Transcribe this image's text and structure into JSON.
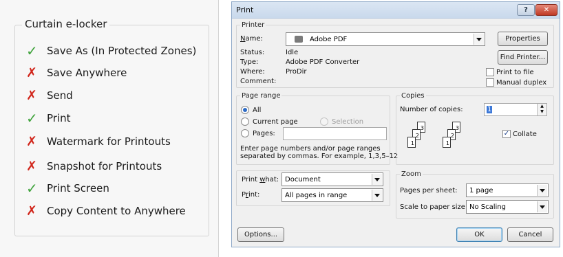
{
  "locker": {
    "title": "Curtain e-locker",
    "items": [
      {
        "status": "allowed",
        "mark": "✓",
        "label": "Save As (In Protected Zones)"
      },
      {
        "status": "denied",
        "mark": "✗",
        "label": "Save Anywhere"
      },
      {
        "status": "denied",
        "mark": "✗",
        "label": "Send"
      },
      {
        "status": "allowed",
        "mark": "✓",
        "label": "Print"
      },
      {
        "status": "denied",
        "mark": "✗",
        "label": "Watermark for Printouts"
      },
      {
        "status": "denied",
        "mark": "✗",
        "label": "Snapshot for Printouts"
      },
      {
        "status": "allowed",
        "mark": "✓",
        "label": "Print Screen"
      },
      {
        "status": "denied",
        "mark": "✗",
        "label": "Copy Content to Anywhere"
      }
    ],
    "colors": {
      "allowed": "#3fa33c",
      "denied": "#d1261b"
    }
  },
  "dialog": {
    "title": "Print",
    "help_label": "?",
    "close_label": "✕",
    "printer": {
      "legend": "Printer",
      "name_label": "Name:",
      "name_value": "Adobe PDF",
      "status_label": "Status:",
      "status_value": "Idle",
      "type_label": "Type:",
      "type_value": "Adobe PDF Converter",
      "where_label": "Where:",
      "where_value": "ProDir",
      "comment_label": "Comment:",
      "properties_button": "Properties",
      "find_printer_button": "Find Printer...",
      "print_to_file": "Print to file",
      "manual_duplex": "Manual duplex"
    },
    "page_range": {
      "legend": "Page range",
      "all": "All",
      "current_page": "Current page",
      "selection": "Selection",
      "pages": "Pages:",
      "hint_line1": "Enter page numbers and/or page ranges",
      "hint_line2": "separated by commas.  For example, 1,3,5–12"
    },
    "copies": {
      "legend": "Copies",
      "number_label": "Number of copies:",
      "number_value": "1",
      "collate": "Collate",
      "collate_checked": true,
      "page_numbers": [
        "1",
        "2",
        "3"
      ]
    },
    "print_what": {
      "label": "Print what:",
      "value": "Document"
    },
    "print": {
      "label": "Print:",
      "value": "All pages in range"
    },
    "zoom": {
      "legend": "Zoom",
      "pages_per_sheet_label": "Pages per sheet:",
      "pages_per_sheet_value": "1 page",
      "scale_label": "Scale to paper size:",
      "scale_value": "No Scaling"
    },
    "options_button": "Options...",
    "ok_button": "OK",
    "cancel_button": "Cancel"
  }
}
